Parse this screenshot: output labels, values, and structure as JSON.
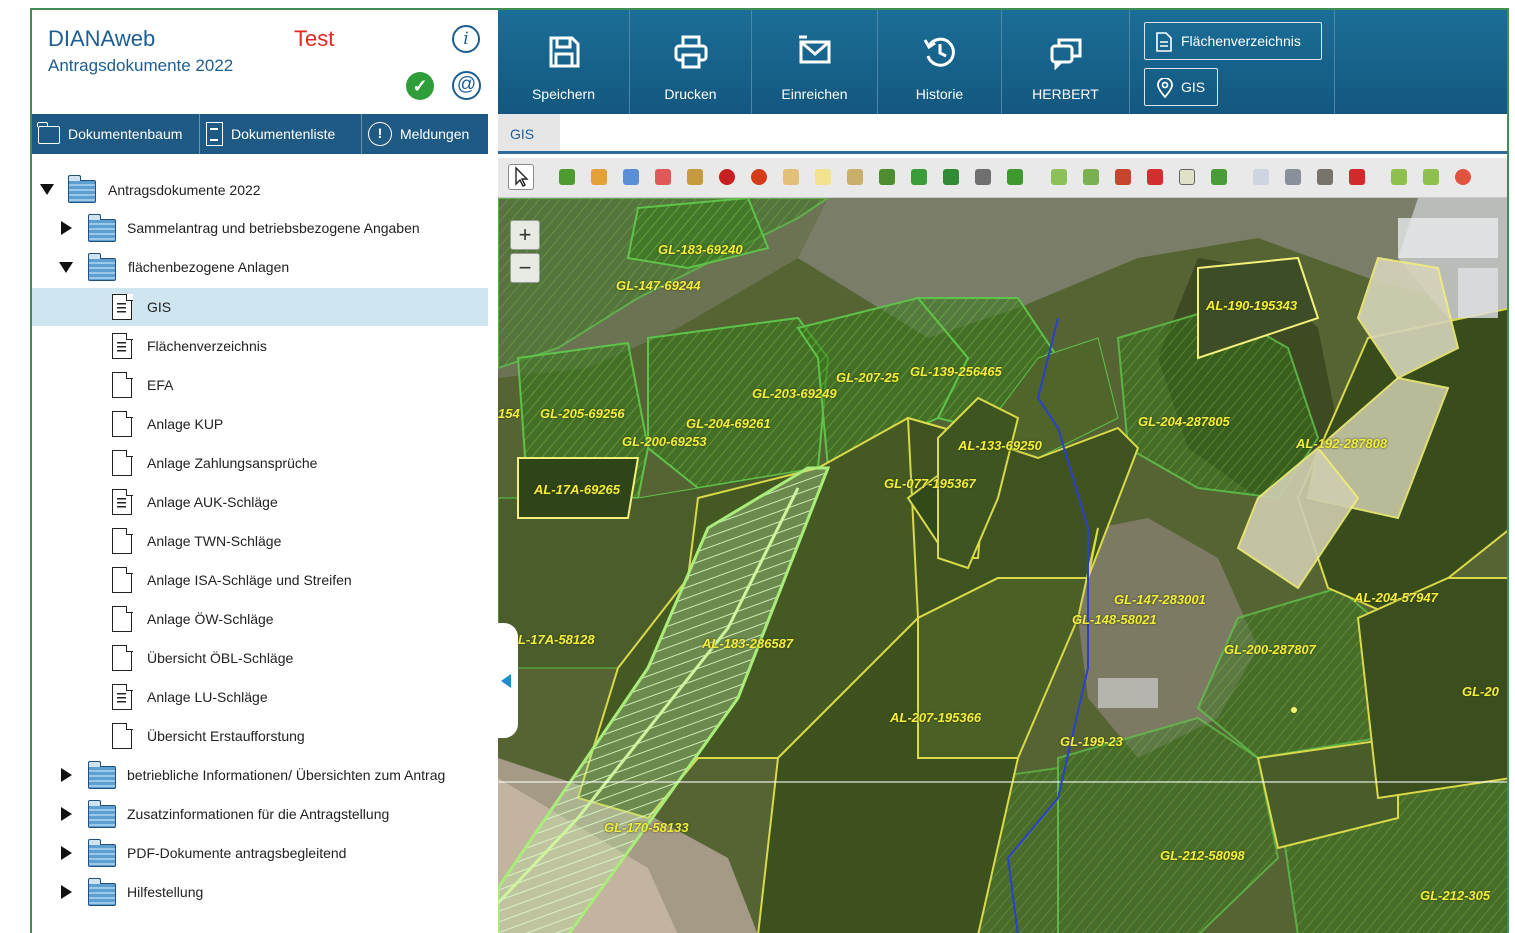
{
  "app": {
    "name": "DIANAweb",
    "subtitle": "Antragsdokumente 2022",
    "env_badge": "Test"
  },
  "colors": {
    "primary_blue": "#1f5a85",
    "toolbar_blue": "#1b6e97",
    "env_red": "#e0281f",
    "selected_row": "#cfe6f1",
    "parcel_label": "#f4ee3a",
    "frame_green": "#3e8e56"
  },
  "doc_tabs": [
    {
      "label": "Dokumentenbaum",
      "icon": "folder-icon"
    },
    {
      "label": "Dokumentenliste",
      "icon": "document-icon"
    },
    {
      "label": "Meldungen",
      "icon": "alert-icon"
    }
  ],
  "tree": {
    "root": "Antragsdokumente 2022",
    "folders": {
      "sammelantrag": "Sammelantrag und betriebsbezogene Angaben",
      "flaechen": "flächenbezogene Anlagen",
      "betrieblich": "betriebliche Informationen/ Übersichten zum Antrag",
      "zusatz": "Zusatzinformationen für die Antragstellung",
      "pdf": "PDF-Dokumente antragsbegleitend",
      "hilfe": "Hilfestellung"
    },
    "documents": [
      "GIS",
      "Flächenverzeichnis",
      "EFA",
      "Anlage KUP",
      "Anlage Zahlungsansprüche",
      "Anlage AUK-Schläge",
      "Anlage TWN-Schläge",
      "Anlage ISA-Schläge und Streifen",
      "Anlage ÖW-Schläge",
      "Übersicht ÖBL-Schläge",
      "Anlage LU-Schläge",
      "Übersicht Erstaufforstung"
    ],
    "selected": "GIS"
  },
  "toolbar": {
    "buttons": [
      {
        "label": "Speichern",
        "icon": "save-icon"
      },
      {
        "label": "Drucken",
        "icon": "print-icon"
      },
      {
        "label": "Einreichen",
        "icon": "submit-icon"
      },
      {
        "label": "Historie",
        "icon": "history-icon"
      },
      {
        "label": "HERBERT",
        "icon": "chat-icon"
      }
    ],
    "side_links": [
      {
        "label": "Flächenverzeichnis",
        "icon": "document-icon"
      },
      {
        "label": "GIS",
        "icon": "map-pin-icon"
      }
    ]
  },
  "gis_tab": "GIS",
  "map": {
    "zoom_in": "+",
    "zoom_out": "−",
    "parcel_labels": [
      "GL-183-69240",
      "GL-147-69244",
      "AL-190-195343",
      "GL-207-25",
      "GL-139-256465",
      "GL-203-69249",
      "GL-205-69256",
      "GL-204-69261",
      "GL-200-69253",
      "AL-133-69250",
      "GL-204-287805",
      "AL-192-287808",
      "AL-17A-69265",
      "GL-077-195367",
      "GL-147-283001",
      "GL-148-58021",
      "AL-204-57947",
      "L-17A-58128",
      "AL-183-286587",
      "GL-200-287807",
      "GL-20",
      "AL-207-195366",
      "GL-199-23",
      "GL-170-58133",
      "GL-212-58098",
      "GL-212-305",
      "154"
    ]
  }
}
